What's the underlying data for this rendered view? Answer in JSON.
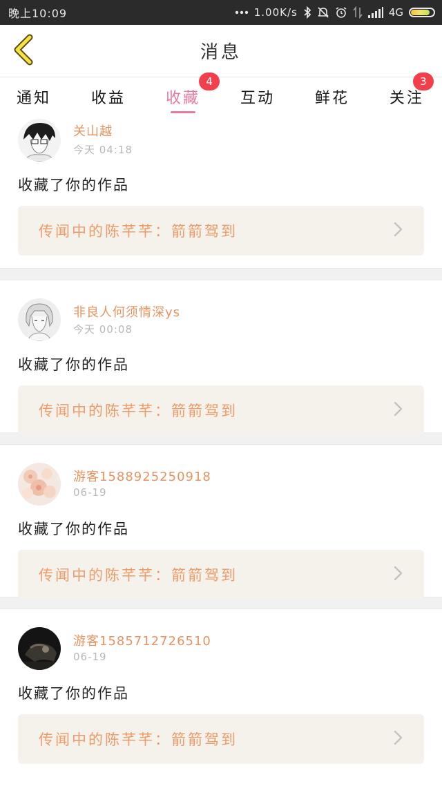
{
  "status_bar": {
    "time": "晚上10:09",
    "speed": "1.00K/s",
    "network": "4G",
    "battery_level": 0.85
  },
  "header": {
    "title": "消息",
    "back_icon": "chevron-left-icon"
  },
  "tabs": [
    {
      "label": "通知",
      "badge": ""
    },
    {
      "label": "收益",
      "badge": ""
    },
    {
      "label": "收藏",
      "badge": "4",
      "active": true
    },
    {
      "label": "互动",
      "badge": ""
    },
    {
      "label": "鲜花",
      "badge": ""
    },
    {
      "label": "关注",
      "badge": "3"
    }
  ],
  "accent_colors": {
    "active_tab": "#e77a9d",
    "username": "#e8935f",
    "badge": "#f23f4b",
    "work_title": "#ee9b6a"
  },
  "feed": [
    {
      "user": "关山越",
      "time": "今天 04:18",
      "action": "收藏了你的作品",
      "work": "传闻中的陈芊芊：箭箭驾到"
    },
    {
      "user": "非良人何须情深ys",
      "time": "今天 00:08",
      "action": "收藏了你的作品",
      "work": "传闻中的陈芊芊：箭箭驾到"
    },
    {
      "user": "游客1588925250918",
      "time": "06-19",
      "action": "收藏了你的作品",
      "work": "传闻中的陈芊芊：箭箭驾到"
    },
    {
      "user": "游客1585712726510",
      "time": "06-19",
      "action": "收藏了你的作品",
      "work": "传闻中的陈芊芊：箭箭驾到"
    }
  ]
}
